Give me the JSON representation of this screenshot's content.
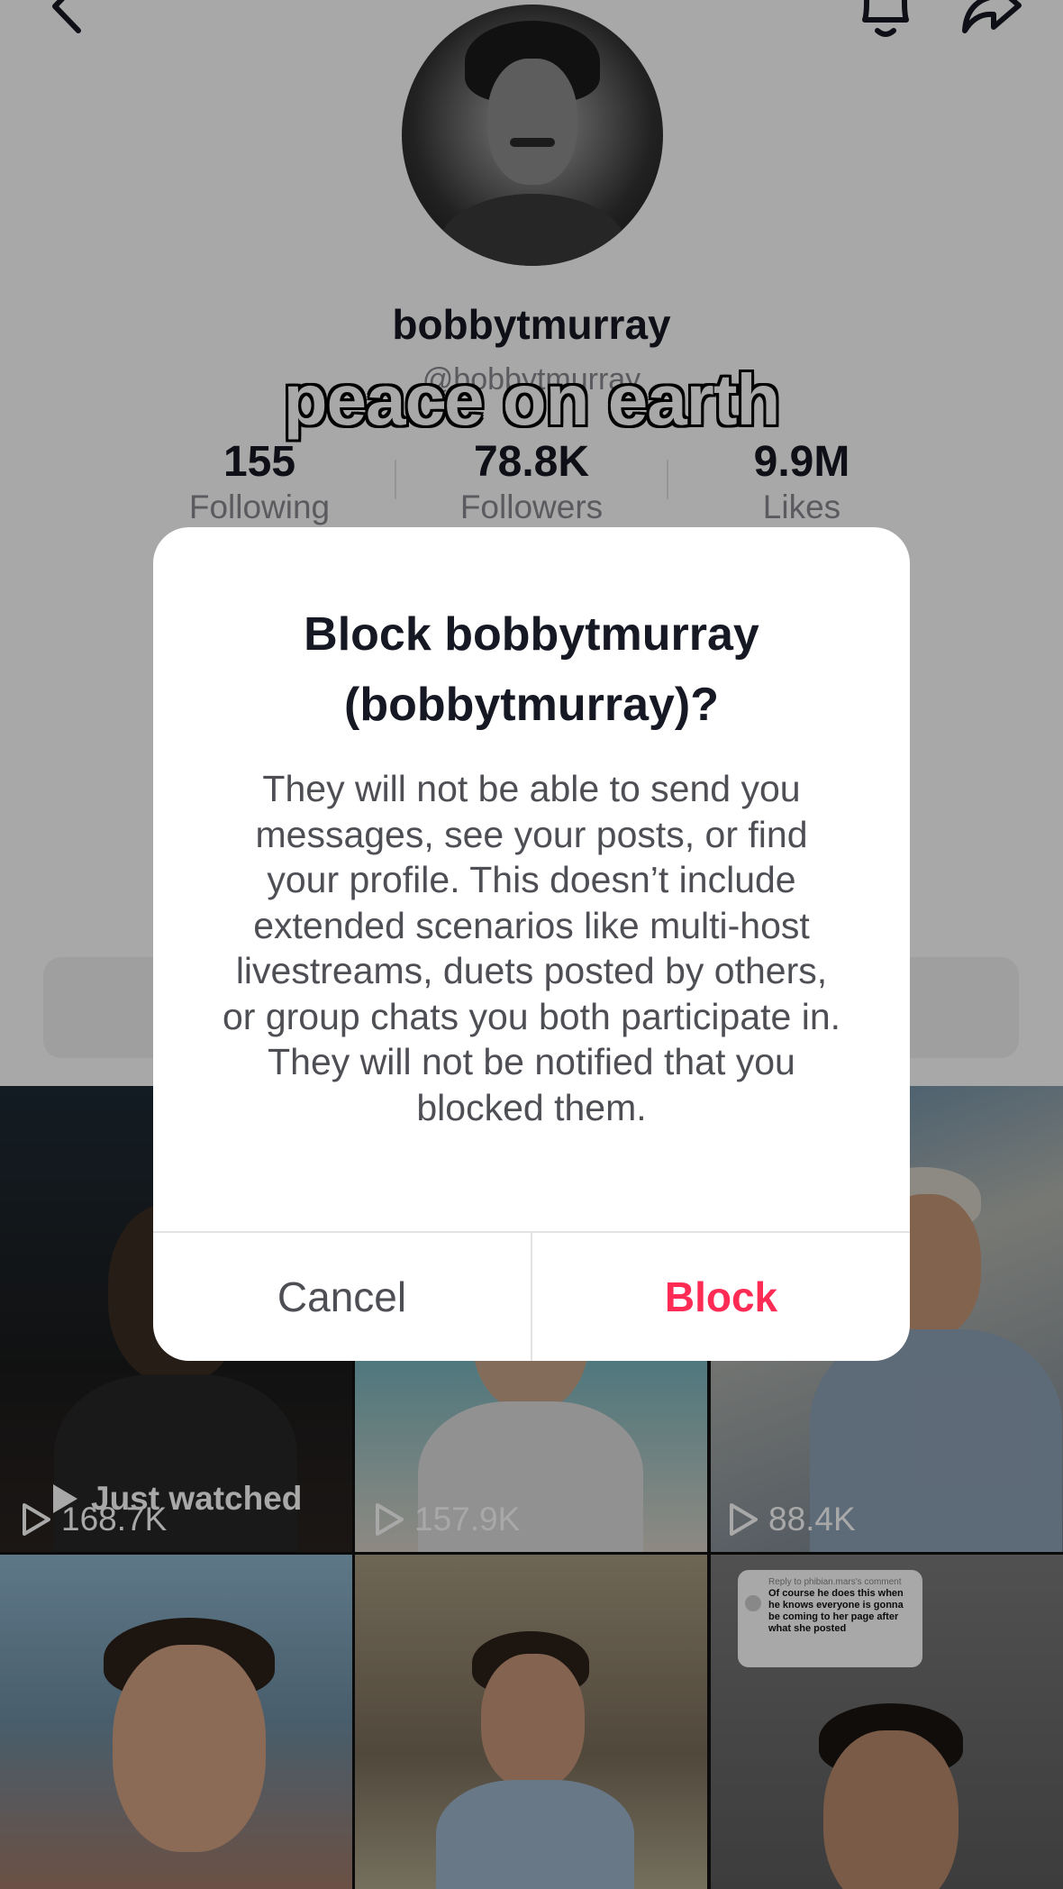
{
  "profile": {
    "display_name": "bobbytmurray",
    "handle": "@bobbytmurray",
    "stats": [
      {
        "value": "155",
        "label": "Following"
      },
      {
        "value": "78.8K",
        "label": "Followers"
      },
      {
        "value": "9.9M",
        "label": "Likes"
      }
    ]
  },
  "caption_overlay": "peace on earth",
  "videos": [
    {
      "views": "168.7K",
      "badge": "Just watched"
    },
    {
      "views": "157.9K"
    },
    {
      "views": "88.4K"
    }
  ],
  "comment_sticker": {
    "reply_to": "Reply to phibian.mars's comment",
    "text": "Of course he does this when he knows everyone is gonna be coming to her page after what she posted"
  },
  "dialog": {
    "title": "Block bobbytmurray (bobbytmurray)?",
    "body": "They will not be able to send you messages, see your posts, or find your profile. This doesn’t include extended scenarios like multi-host livestreams, duets posted by others, or group chats you both participate in. They will not be notified that you blocked them.",
    "cancel_label": "Cancel",
    "block_label": "Block"
  },
  "colors": {
    "accent": "#fe2c55",
    "text_primary": "#161823",
    "text_secondary": "#8a8b91"
  }
}
